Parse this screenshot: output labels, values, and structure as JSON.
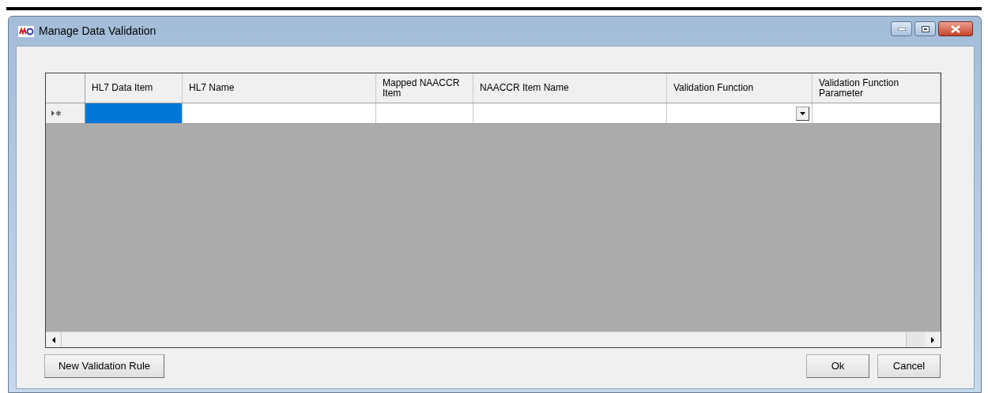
{
  "window": {
    "title": "Manage Data Validation"
  },
  "grid": {
    "columns": [
      {
        "label": "HL7 Data Item"
      },
      {
        "label": "HL7 Name"
      },
      {
        "label": "Mapped NAACCR Item"
      },
      {
        "label": "NAACCR Item Name"
      },
      {
        "label": "Validation Function"
      },
      {
        "label": "Validation Function Parameter"
      }
    ],
    "new_row": {
      "cells": [
        {
          "kind": "text",
          "selected": true
        },
        {
          "kind": "text",
          "selected": false
        },
        {
          "kind": "text",
          "selected": false
        },
        {
          "kind": "text",
          "selected": false
        },
        {
          "kind": "combo",
          "selected": false
        },
        {
          "kind": "text",
          "selected": false
        }
      ]
    }
  },
  "buttons": {
    "left": [
      "New Validation Rule"
    ],
    "right": [
      "Ok",
      "Cancel"
    ]
  }
}
